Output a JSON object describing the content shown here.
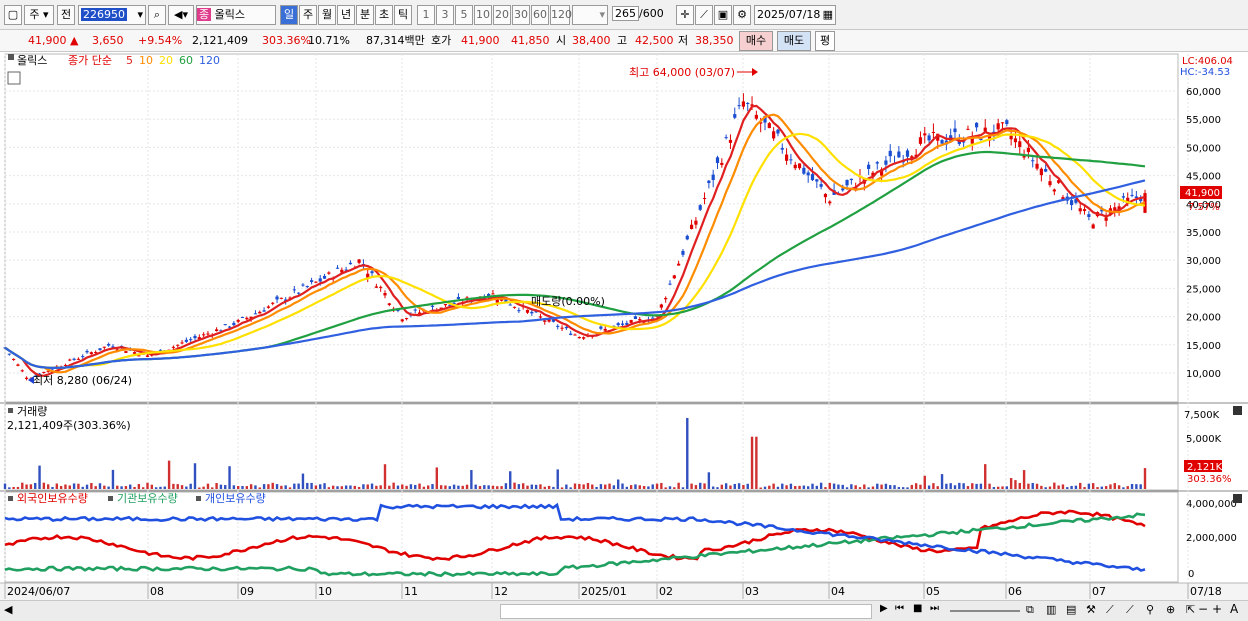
{
  "toolbar": {
    "market": "주",
    "prev_label": "전",
    "code": "226950",
    "name": "올릭스",
    "periods": [
      "일",
      "주",
      "월",
      "년",
      "분",
      "초",
      "틱"
    ],
    "intervals": [
      "1",
      "3",
      "5",
      "10",
      "20",
      "30",
      "60",
      "120"
    ],
    "count": "265",
    "count_total": "/600",
    "date": "2025/07/18"
  },
  "quote": {
    "price": "41,900",
    "change": "3,650",
    "change_pct": "+9.54%",
    "volume": "2,121,409",
    "vol_ratio": "303.36%",
    "turnover": "10.71%",
    "amount": "87,314백만",
    "bid_label": "호가",
    "bid_price": "41,900",
    "bid2": "41,850",
    "open_label": "시",
    "open": "38,400",
    "high_label": "고",
    "high": "42,500",
    "low_label": "저",
    "low": "38,350",
    "buy_label": "매수",
    "sell_label": "매도",
    "eval_label": "평"
  },
  "price_panel": {
    "title": "올릭스",
    "ma_label": "종가 단순",
    "ma_periods": [
      "5",
      "10",
      "20",
      "60",
      "120"
    ],
    "ma_colors": [
      "#e02020",
      "#ff8c00",
      "#ffe000",
      "#20a040",
      "#3060e0"
    ],
    "lc": "LC:406.04",
    "hc": "HC:-34.53",
    "y_ticks": [
      "60,000",
      "55,000",
      "50,000",
      "45,000",
      "40,000",
      "35,000",
      "30,000",
      "25,000",
      "20,000",
      "15,000",
      "10,000"
    ],
    "last_price": "41,900",
    "last_pct": "7.57%",
    "high_annotation": "최고 64,000 (03/07)",
    "low_annotation": "최저 8,280 (06/24)",
    "mid_annotation": "매도량(0.00%)"
  },
  "volume_panel": {
    "title": "거래량",
    "value": "2,121,409주(303.36%)",
    "y_ticks": [
      "7,500K",
      "5,000K"
    ],
    "last_value": "2,121K",
    "last_pct": "303.36%"
  },
  "holdings_panel": {
    "series": [
      "외국인보유수량",
      "기관보유수량",
      "개인보유수량"
    ],
    "series_colors": [
      "#e00000",
      "#20a060",
      "#2050e0"
    ],
    "y_ticks": [
      "4,000,000",
      "2,000,000",
      "0"
    ]
  },
  "x_axis": {
    "labels": [
      "2024/06/07",
      "08",
      "09",
      "10",
      "11",
      "12",
      "2025/01",
      "02",
      "03",
      "04",
      "05",
      "06",
      "07",
      "07/18"
    ]
  },
  "chart_data": {
    "type": "candlestick",
    "title": "올릭스",
    "ylim": [
      5000,
      65000
    ],
    "close_samples": [
      {
        "date": "2024/06/07",
        "close": 14500
      },
      {
        "date": "2024/06/24",
        "close": 9000
      },
      {
        "date": "2024/07",
        "close": 15000
      },
      {
        "date": "2024/08",
        "close": 13000
      },
      {
        "date": "2024/09",
        "close": 19000
      },
      {
        "date": "2024/10",
        "close": 30000
      },
      {
        "date": "2024/11",
        "close": 20000
      },
      {
        "date": "2024/12",
        "close": 24000
      },
      {
        "date": "2025/01",
        "close": 16500
      },
      {
        "date": "2025/02",
        "close": 20000
      },
      {
        "date": "2025/03",
        "close": 58000
      },
      {
        "date": "2025/04",
        "close": 41000
      },
      {
        "date": "2025/05",
        "close": 51000
      },
      {
        "date": "2025/06",
        "close": 53000
      },
      {
        "date": "2025/07",
        "close": 37000
      },
      {
        "date": "2025/07/18",
        "close": 41900
      }
    ]
  }
}
